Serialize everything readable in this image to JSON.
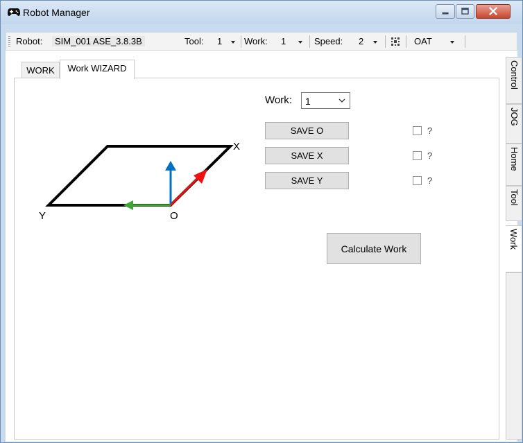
{
  "window": {
    "title": "Robot Manager",
    "icon": "gamepad-icon"
  },
  "toolbar": {
    "robot_label": "Robot:",
    "robot_value": "SIM_001 ASE_3.8.3B",
    "tool_label": "Tool:",
    "tool_value": "1",
    "work_label": "Work:",
    "work_value": "1",
    "speed_label": "Speed:",
    "speed_value": "2",
    "grid_icon": "grid-icon",
    "frame_value": "OAT"
  },
  "tabs": [
    "WORK",
    "Work WIZARD"
  ],
  "side_tabs": [
    "Control",
    "JOG",
    "Home",
    "Tool",
    "Work"
  ],
  "wizard": {
    "work_label": "Work:",
    "work_selected": "1",
    "save_o": "SAVE O",
    "save_x": "SAVE X",
    "save_y": "SAVE Y",
    "status_o": "?",
    "status_x": "?",
    "status_y": "?",
    "calculate": "Calculate Work"
  },
  "diagram": {
    "label_x": "X",
    "label_y": "Y",
    "label_o": "O",
    "colors": {
      "outline": "#000000",
      "x_axis": "#ee1111",
      "y_axis": "#3fa535",
      "z_axis": "#0070c0"
    }
  }
}
